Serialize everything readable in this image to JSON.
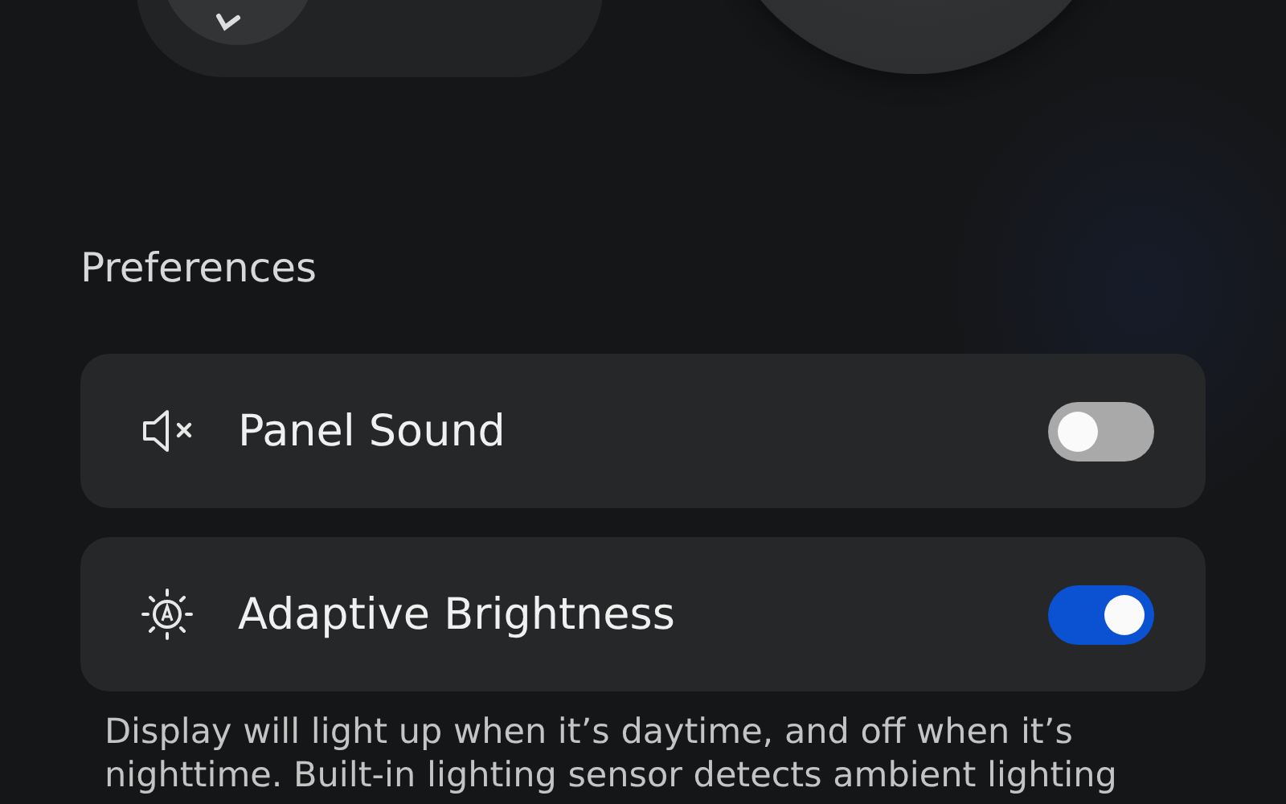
{
  "section_title": "Preferences",
  "settings": [
    {
      "kind": "sound",
      "label": "Panel Sound",
      "on": false
    },
    {
      "kind": "brightness",
      "label": "Adaptive Brightness",
      "on": true
    }
  ],
  "description": "Display will light up when it’s daytime, and off when it’s nighttime. Built-in lighting sensor detects ambient lighting"
}
